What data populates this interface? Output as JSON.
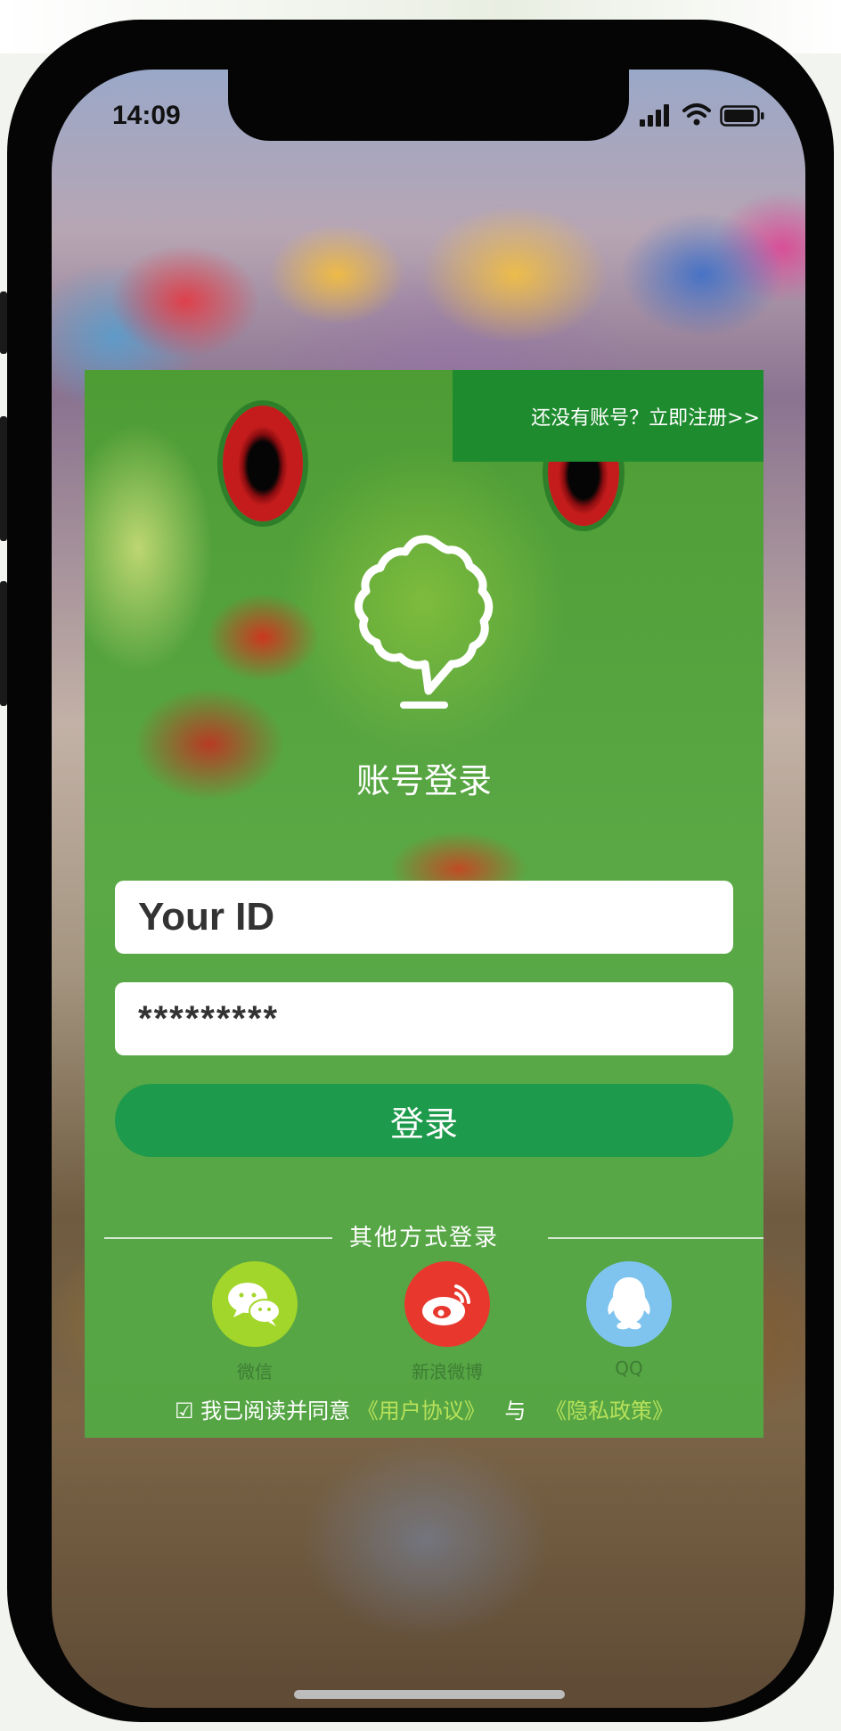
{
  "status": {
    "time": "14:09",
    "icons": [
      "signal-icon",
      "wifi-icon",
      "battery-icon"
    ]
  },
  "login": {
    "register_link": "还没有账号？立即注册>>",
    "title": "账号登录",
    "id_field_value": "Your ID",
    "password_field_value": "*********",
    "login_button": "登录",
    "other_methods_label": "其他方式登录"
  },
  "social": [
    {
      "label": "微信",
      "icon": "wechat-icon",
      "color": "#a3d62a"
    },
    {
      "label": "新浪微博",
      "icon": "weibo-icon",
      "color": "#e8382e"
    },
    {
      "label": "QQ",
      "icon": "qq-icon",
      "color": "#7fc4ef"
    }
  ],
  "agreement": {
    "checkbox": "☑",
    "prefix": "我已阅读并同意",
    "user_agreement": "《用户协议》",
    "conjunction": "与",
    "privacy_policy": "《隐私政策》"
  },
  "colors": {
    "card_green": "#55a544",
    "header_green": "#1e8b2e",
    "button_green": "#1e9a4c",
    "link_green": "#b7e15a"
  }
}
